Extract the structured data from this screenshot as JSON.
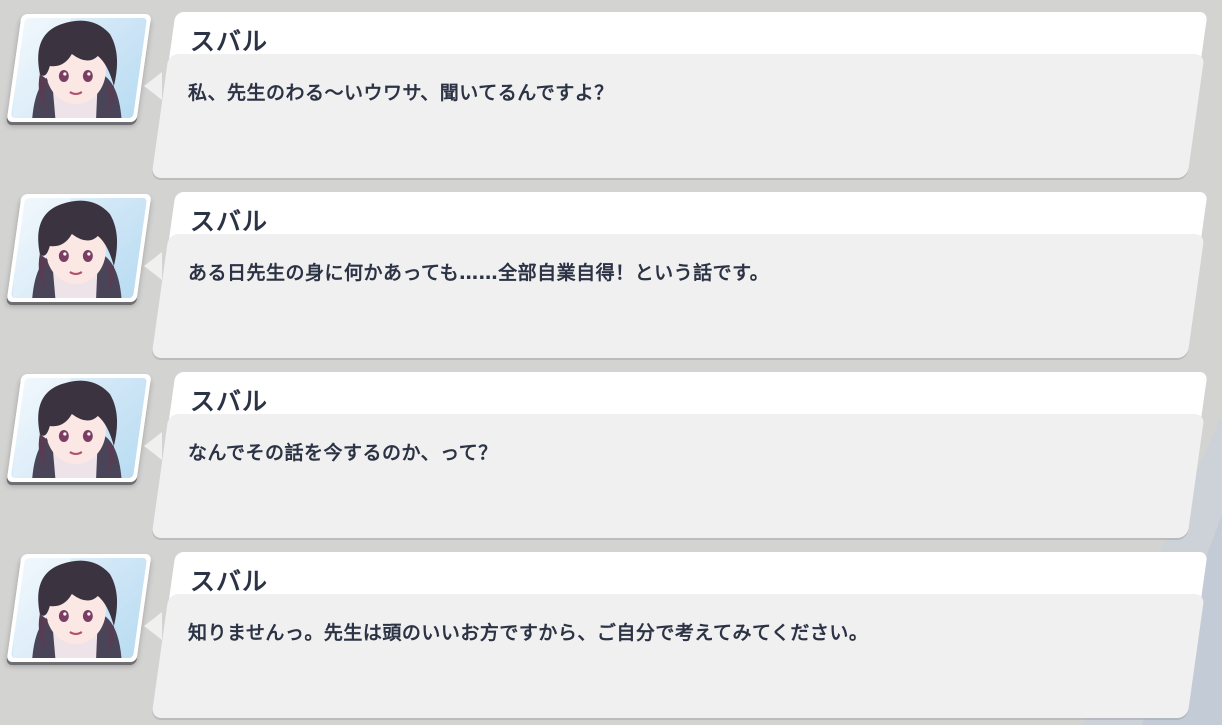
{
  "dialogue_log": [
    {
      "speaker": "スバル",
      "text": "私、先生のわる～いウワサ、聞いてるんですよ？"
    },
    {
      "speaker": "スバル",
      "text": "ある日先生の身に何かあっても……全部自業自得！という話です。"
    },
    {
      "speaker": "スバル",
      "text": "なんでその話を今するのか、って？"
    },
    {
      "speaker": "スバル",
      "text": "知りませんっ。先生は頭のいいお方ですから、ご自分で考えてみてください。"
    }
  ],
  "colors": {
    "background": "#d3d3d2",
    "name_bar": "#ffffff",
    "text_panel": "#f0f0f0",
    "text": "#2c3345",
    "avatar_hair": "#3b3440",
    "avatar_bg": "#cfe6f6"
  },
  "icons": {
    "portrait": "character-portrait"
  }
}
